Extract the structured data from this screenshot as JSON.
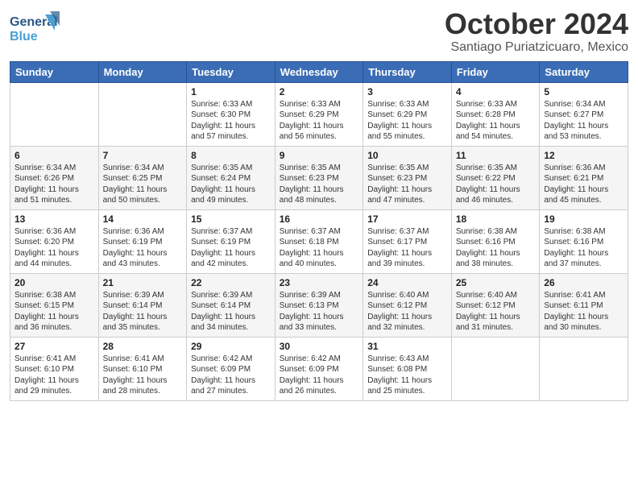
{
  "header": {
    "logo_line1": "General",
    "logo_line2": "Blue",
    "month_title": "October 2024",
    "subtitle": "Santiago Puriatzicuaro, Mexico"
  },
  "calendar": {
    "days_of_week": [
      "Sunday",
      "Monday",
      "Tuesday",
      "Wednesday",
      "Thursday",
      "Friday",
      "Saturday"
    ],
    "weeks": [
      [
        {
          "day": "",
          "info": ""
        },
        {
          "day": "",
          "info": ""
        },
        {
          "day": "1",
          "info": "Sunrise: 6:33 AM\nSunset: 6:30 PM\nDaylight: 11 hours\nand 57 minutes."
        },
        {
          "day": "2",
          "info": "Sunrise: 6:33 AM\nSunset: 6:29 PM\nDaylight: 11 hours\nand 56 minutes."
        },
        {
          "day": "3",
          "info": "Sunrise: 6:33 AM\nSunset: 6:29 PM\nDaylight: 11 hours\nand 55 minutes."
        },
        {
          "day": "4",
          "info": "Sunrise: 6:33 AM\nSunset: 6:28 PM\nDaylight: 11 hours\nand 54 minutes."
        },
        {
          "day": "5",
          "info": "Sunrise: 6:34 AM\nSunset: 6:27 PM\nDaylight: 11 hours\nand 53 minutes."
        }
      ],
      [
        {
          "day": "6",
          "info": "Sunrise: 6:34 AM\nSunset: 6:26 PM\nDaylight: 11 hours\nand 51 minutes."
        },
        {
          "day": "7",
          "info": "Sunrise: 6:34 AM\nSunset: 6:25 PM\nDaylight: 11 hours\nand 50 minutes."
        },
        {
          "day": "8",
          "info": "Sunrise: 6:35 AM\nSunset: 6:24 PM\nDaylight: 11 hours\nand 49 minutes."
        },
        {
          "day": "9",
          "info": "Sunrise: 6:35 AM\nSunset: 6:23 PM\nDaylight: 11 hours\nand 48 minutes."
        },
        {
          "day": "10",
          "info": "Sunrise: 6:35 AM\nSunset: 6:23 PM\nDaylight: 11 hours\nand 47 minutes."
        },
        {
          "day": "11",
          "info": "Sunrise: 6:35 AM\nSunset: 6:22 PM\nDaylight: 11 hours\nand 46 minutes."
        },
        {
          "day": "12",
          "info": "Sunrise: 6:36 AM\nSunset: 6:21 PM\nDaylight: 11 hours\nand 45 minutes."
        }
      ],
      [
        {
          "day": "13",
          "info": "Sunrise: 6:36 AM\nSunset: 6:20 PM\nDaylight: 11 hours\nand 44 minutes."
        },
        {
          "day": "14",
          "info": "Sunrise: 6:36 AM\nSunset: 6:19 PM\nDaylight: 11 hours\nand 43 minutes."
        },
        {
          "day": "15",
          "info": "Sunrise: 6:37 AM\nSunset: 6:19 PM\nDaylight: 11 hours\nand 42 minutes."
        },
        {
          "day": "16",
          "info": "Sunrise: 6:37 AM\nSunset: 6:18 PM\nDaylight: 11 hours\nand 40 minutes."
        },
        {
          "day": "17",
          "info": "Sunrise: 6:37 AM\nSunset: 6:17 PM\nDaylight: 11 hours\nand 39 minutes."
        },
        {
          "day": "18",
          "info": "Sunrise: 6:38 AM\nSunset: 6:16 PM\nDaylight: 11 hours\nand 38 minutes."
        },
        {
          "day": "19",
          "info": "Sunrise: 6:38 AM\nSunset: 6:16 PM\nDaylight: 11 hours\nand 37 minutes."
        }
      ],
      [
        {
          "day": "20",
          "info": "Sunrise: 6:38 AM\nSunset: 6:15 PM\nDaylight: 11 hours\nand 36 minutes."
        },
        {
          "day": "21",
          "info": "Sunrise: 6:39 AM\nSunset: 6:14 PM\nDaylight: 11 hours\nand 35 minutes."
        },
        {
          "day": "22",
          "info": "Sunrise: 6:39 AM\nSunset: 6:14 PM\nDaylight: 11 hours\nand 34 minutes."
        },
        {
          "day": "23",
          "info": "Sunrise: 6:39 AM\nSunset: 6:13 PM\nDaylight: 11 hours\nand 33 minutes."
        },
        {
          "day": "24",
          "info": "Sunrise: 6:40 AM\nSunset: 6:12 PM\nDaylight: 11 hours\nand 32 minutes."
        },
        {
          "day": "25",
          "info": "Sunrise: 6:40 AM\nSunset: 6:12 PM\nDaylight: 11 hours\nand 31 minutes."
        },
        {
          "day": "26",
          "info": "Sunrise: 6:41 AM\nSunset: 6:11 PM\nDaylight: 11 hours\nand 30 minutes."
        }
      ],
      [
        {
          "day": "27",
          "info": "Sunrise: 6:41 AM\nSunset: 6:10 PM\nDaylight: 11 hours\nand 29 minutes."
        },
        {
          "day": "28",
          "info": "Sunrise: 6:41 AM\nSunset: 6:10 PM\nDaylight: 11 hours\nand 28 minutes."
        },
        {
          "day": "29",
          "info": "Sunrise: 6:42 AM\nSunset: 6:09 PM\nDaylight: 11 hours\nand 27 minutes."
        },
        {
          "day": "30",
          "info": "Sunrise: 6:42 AM\nSunset: 6:09 PM\nDaylight: 11 hours\nand 26 minutes."
        },
        {
          "day": "31",
          "info": "Sunrise: 6:43 AM\nSunset: 6:08 PM\nDaylight: 11 hours\nand 25 minutes."
        },
        {
          "day": "",
          "info": ""
        },
        {
          "day": "",
          "info": ""
        }
      ]
    ]
  }
}
